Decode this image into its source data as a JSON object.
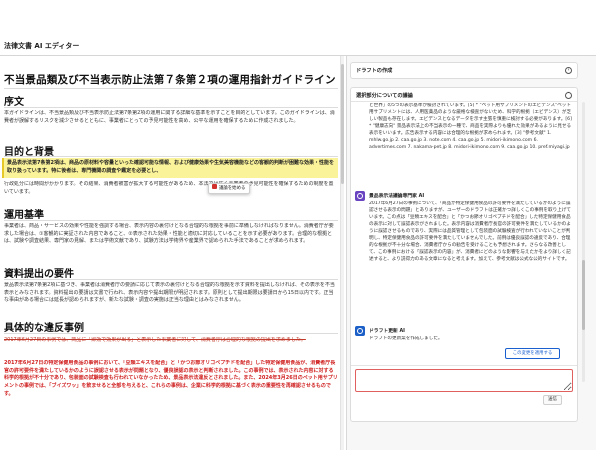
{
  "app": {
    "title": "法律文書 AI エディター"
  },
  "document": {
    "title": "不当景品類及び不当表示防止法第７条第２項の運用指針ガイドライン",
    "sections": [
      {
        "heading": "序文",
        "text": "本ガイドラインは、不当景品類及び不当表示防止法第7条第2項の運用に関する詳細な基準を示すことを目的としています。このガイドラインは、消費者が誤解するリスクを減少させるとともに、事業者にとっての予見可能性を高め、公平な運用を確保するために作成されました。"
      },
      {
        "heading": "目的と背景",
        "highlighted": "景品表示法第7条第2項は、商品の原材料や容量といった確認可能な情報、および健康効果や生気美容機能などの客観的判断が困難な効果・性能を取り扱っています。特に後者は、専門機関の調査や鑑定を必要とし、",
        "text": "行政処分には時間がかかります。その結果、消費者被害が拡大する可能性があるため、本法では広く事業者の予見可能性を確保するための制度を置いています。"
      },
      {
        "heading": "運用基準",
        "text": "事業者は、商品・サービスの効果や性能を強調する場合、表示内容の裏付けとなる合理的な根拠を事前に準備しなければなりません。消費者庁が要求した場合は、①客観的に実証された内容であること、②表示された効果・性能と適切に対応していることを示す必要があります。合理的な根拠とは、試験や調査結果、専門家の見解、または学術文献であり、試験方法は学術界や産業界で認められた手法であることが求められます。"
      },
      {
        "heading": "資料提出の要件",
        "text": "景品表示法第7条第2項に基づき、事業者は消費者庁の要請に応じて表示の裏付けとなる合理的な根拠を示す資料を提出しなければ、その表示を不当表示とみなされます。資料提出の要請は文書で行われ、表示内容や提出期限が明記されます。原則として提出期限は要請日から15日以内です。正当な事由がある場合には延長が認められますが、新たな試験・調査の実施は正当な理由とはみなされません。"
      },
      {
        "heading": "具体的な違反事例",
        "deleted": "2017年6月27日の事例では、商品に「即効で効果が出る」と表示した事業者に対して、消費者庁は合理的な根拠の提出を求めました。",
        "inserted": "2017年6月27日の特定保健用食品の事例において、「豆類エキスを配合」と「かつお節オリゴペプチドを配合」した特定保健用食品が、消費者庁長官の許可要件を満たしているかのように誤認させる表示が問題となり、優良誤認の表示と判断されました。この事例では、表示された内容に対する科学的根拠が不十分であり、包装面の試験検査も行われていなかったため、景品表示法違反とされました。また、2024年3月26日のペット用サプリメントの事例では、「ブイズワッ」を飲ませると全部を与えると、これらの事例は、企業に科学的根拠に基づく表示の重要性を再確認させるものです。"
      }
    ],
    "tooltip_label": "議論を始める"
  },
  "panel": {
    "draft_section_title": "ドラフトの作成",
    "discussion_title": "選択部分についての議論",
    "message1_text": "と世界」の5つの表示基準が検討されています。[5] * \"ペット用サプリメントのエビデンス\"ペット用サプリメントには、人用医薬品のような厳格な検査がないため、科学的根拠（エビデンス）が乏しい製品も存在します。エビデンスとなるデータを示す主張を慎重に検討する必要があります。[6] * \"健康志向\" 景品表示法上の不当表示の一種で、商品を実際よりも優れた効果があるように見せる表示をいいます。広告表示する内容には合理的な根拠が求められます。[3] \"参考文献\" 1. mhlw.go.jp 2. caa.go.jp 3. note.com 4. caa.go.jp 5. midori-ikimono.com 6. advertimes.com 7. nakama-pet.jp 8. midori-ikimono.com 9. caa.go.jp 10. pref.miyagi.jp",
    "message2_author": "景品表示法議論専門家 AI",
    "message2_text": "2017年6月27日の事例について、「商品が特定保健用食品の許可要件を満たしているかのように誤認させる表示の問題」とありますが、ユーザーのドラフトは正確かつ詳しくこの事例を取り上げています。この点は「豆類エキスを配合」と「かつお節オリゴペプチドを配合」した特定保健用食品の表示に対して誤認表示がされました。表示内容は消費者庁長官の許可要件を満たしているかのように誤認させるものであり、実際には品質管理として包装面の試験検査が行われていないことが判明し、特定保健用食品の許可要件を満たしていませんでした。前例は優良誤認の違反であり、合理的な根拠が不十分な場合、消費者庁からの勧告を受けることも予想されます。さらなる改善として、この事例における「誤認表示の内容」が、消費者にどのような影響を与えたかをより詳しく記述すると、より説得力のある文章になると考えます。加えて、参考文献は公式な公的サイトです。",
    "message3_author": "ドラフト更新 AI",
    "message3_text": "ドラフトの更新案を作成しました。",
    "apply_label": "この変更を適用する",
    "send_label": "送信"
  }
}
